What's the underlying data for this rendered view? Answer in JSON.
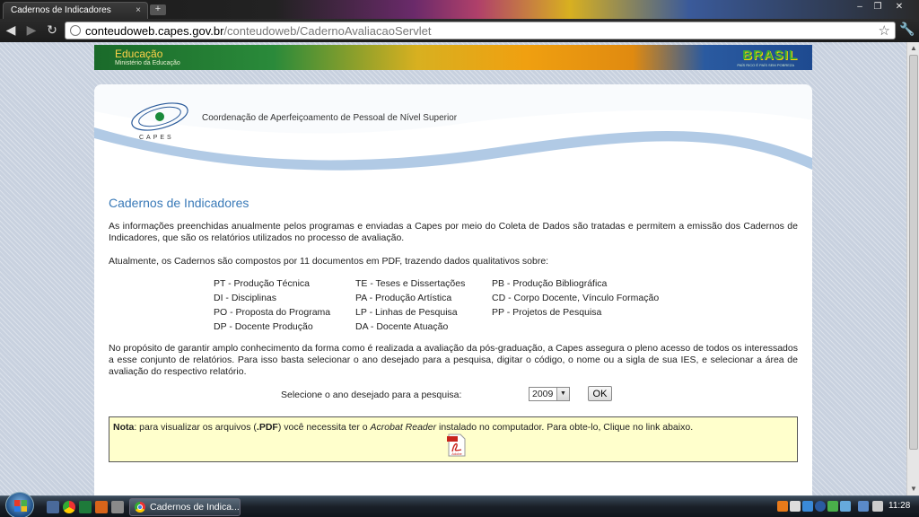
{
  "browser": {
    "tab_title": "Cadernos de Indicadores",
    "tab_close": "×",
    "new_tab": "+",
    "url_host": "conteudoweb.capes.gov.br",
    "url_path": "/conteudoweb/CadernoAvaliacaoServlet",
    "minimize": "–",
    "maximize": "❐",
    "close": "✕",
    "back": "◀",
    "forward": "▶",
    "reload": "↻",
    "star": "☆",
    "wrench": "🔧"
  },
  "gov_banner": {
    "title": "Educação",
    "subtitle": "Ministério da Educação",
    "brand": "BRASIL",
    "tagline": "PAÍS RICO É PAÍS SEM POBREZA"
  },
  "header": {
    "logo_word": "CAPES",
    "org_name": "Coordenação de Aperfeiçoamento de Pessoal de Nível Superior"
  },
  "main": {
    "title": "Cadernos de Indicadores",
    "intro": "As informações preenchidas anualmente pelos programas e enviadas a Capes por meio do Coleta de Dados são tratadas e permitem a emissão dos Cadernos de Indicadores, que são os relatórios utilizados no processo de avaliação.",
    "composition": "Atualmente, os Cadernos são compostos por 11 documentos em PDF, trazendo dados qualitativos sobre:",
    "documents": [
      [
        "PT - Produção Técnica",
        "DI - Disciplinas",
        "PO - Proposta do Programa",
        "DP - Docente Produção"
      ],
      [
        "TE - Teses e Dissertações",
        "PA - Produção Artística",
        "LP - Linhas de Pesquisa",
        "DA - Docente Atuação"
      ],
      [
        "PB - Produção Bibliográfica",
        "CD - Corpo Docente, Vínculo Formação",
        "PP - Projetos de Pesquisa"
      ]
    ],
    "access": "No propósito de garantir amplo conhecimento da forma como é realizada a avaliação da pós-graduação, a Capes assegura o pleno acesso de todos os interessados a esse conjunto de relatórios. Para isso basta selecionar o ano desejado para a pesquisa, digitar o código, o nome ou a sigla de sua IES, e selecionar a área de avaliação do respectivo relatório.",
    "year_label": "Selecione o ano desejado para a pesquisa:",
    "year_value": "2009",
    "ok_label": "OK",
    "note": {
      "label": "Nota",
      "t1": ": para visualizar os arquivos (",
      "pdf": ".PDF",
      "t2": ") você necessita ter o ",
      "reader": "Acrobat Reader",
      "t3": " instalado no computador. Para obte-lo, Clique no link abaixo.",
      "pdf_icon_text": "Adobe"
    }
  },
  "taskbar": {
    "task_title": "Cadernos de Indica...",
    "clock": "11:28"
  },
  "colors": {
    "title_blue": "#3a7ab8",
    "note_bg": "#ffffcc",
    "wave_blue": "#a9c4e2"
  }
}
